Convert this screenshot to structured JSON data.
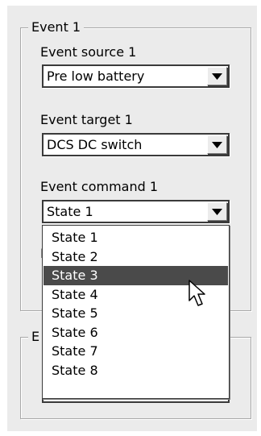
{
  "event1": {
    "group_title": "Event 1",
    "source_label": "Event source 1",
    "source_value": "Pre low battery",
    "target_label": "Event target 1",
    "target_value": "DCS DC switch",
    "command_label": "Event command 1",
    "command_value": "State 1"
  },
  "event2": {
    "group_title": "E"
  },
  "dropdown": {
    "options": [
      "State 1",
      "State 2",
      "State 3",
      "State 4",
      "State 5",
      "State 6",
      "State 7",
      "State 8"
    ],
    "selected_index": 2
  },
  "hidden_label_fragment": "E",
  "icons": {
    "combo_arrow": "chevron-down-icon",
    "pointer": "mouse-cursor-icon"
  },
  "colors": {
    "panel_bg": "#ebebeb",
    "selection_bg": "#4a4a4a",
    "selection_fg": "#ffffff"
  }
}
